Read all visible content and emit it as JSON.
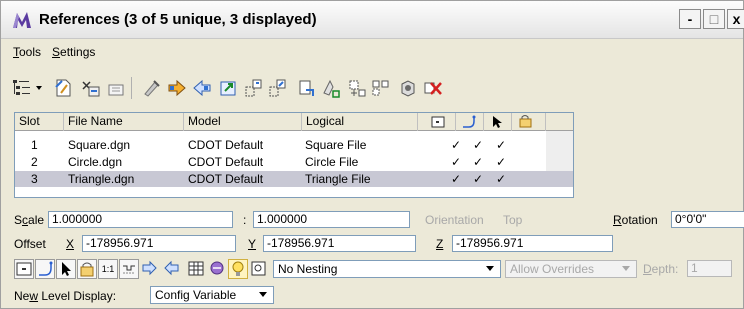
{
  "window": {
    "title": "References (3 of 5 unique, 3 displayed)",
    "minimize_label": "-",
    "restore_label": "□",
    "close_label": "x"
  },
  "menu": {
    "tools_first": "T",
    "tools_rest": "ools",
    "settings_first": "S",
    "settings_rest": "ettings"
  },
  "table": {
    "headers": [
      "Slot",
      "File Name",
      "Model",
      "Logical"
    ],
    "rows": [
      {
        "slot": "1",
        "file": "Square.dgn",
        "model": "CDOT Default",
        "logical": "Square File",
        "display": "✓",
        "snap": "✓",
        "locate": "✓"
      },
      {
        "slot": "2",
        "file": "Circle.dgn",
        "model": "CDOT Default",
        "logical": "Circle File",
        "display": "✓",
        "snap": "✓",
        "locate": "✓"
      },
      {
        "slot": "3",
        "file": "Triangle.dgn",
        "model": "CDOT Default",
        "logical": "Triangle File",
        "display": "✓",
        "snap": "✓",
        "locate": "✓"
      }
    ],
    "selected_row": 3
  },
  "settings": {
    "scale_label_u": "c",
    "scale_label_pre": "S",
    "scale_label_post": "ale",
    "scale_value_1": "1.000000",
    "scale_sep": ":",
    "scale_value_2": "1.000000",
    "orientation_label": "Orientation",
    "orientation_value": "Top",
    "rotation_label_u": "R",
    "rotation_label_rest": "otation",
    "rotation_value": "0°0'0\"",
    "offset_label": "Offset",
    "offset_x_label": "X",
    "offset_x_value": "-178956.971",
    "offset_y_label": "Y",
    "offset_y_value": "-178956.971",
    "offset_z_label": "Z",
    "offset_z_value": "-178956.971",
    "nesting_value": "No Nesting",
    "overrides_value": "Allow Overrides",
    "depth_label_u": "D",
    "depth_label_rest": "epth:",
    "depth_value": "1",
    "new_level_label_pre": "Ne",
    "new_level_label_u": "w",
    "new_level_label_post": " Level Display:",
    "new_level_value": "Config Variable",
    "scale_ratio_label": "1:1"
  },
  "colors": {
    "accent_purple": "#4b2a8a",
    "selected_row": "#c8c8d4",
    "close_red": "#d42020",
    "arrow_blue": "#2a5fd0"
  }
}
